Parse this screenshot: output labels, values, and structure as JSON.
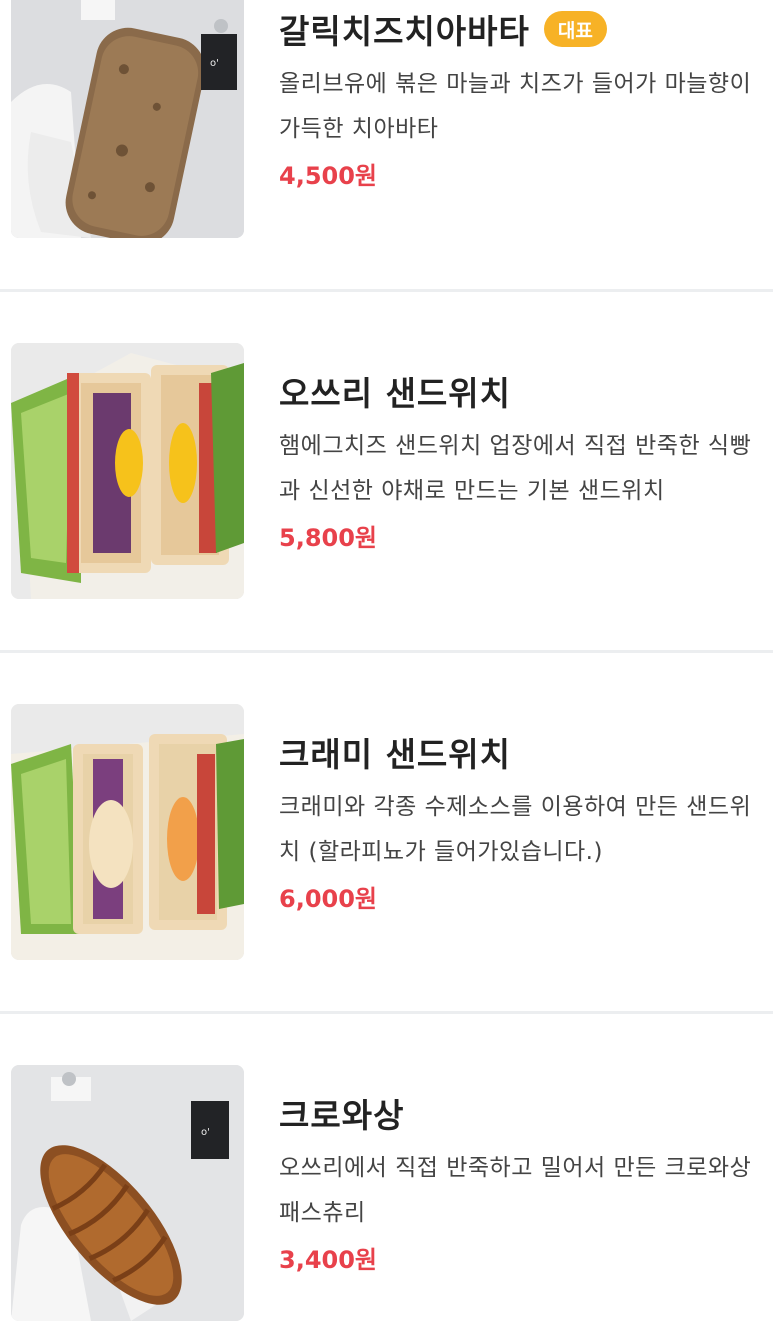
{
  "menu": {
    "items": [
      {
        "name": "갈릭치즈치아바타",
        "badge": "대표",
        "description": "올리브유에 볶은 마늘과 치즈가 들어가 마늘향이 가득한 치아바타",
        "price": "4,500원",
        "image_icon": "ciabatta-photo"
      },
      {
        "name": "오쓰리 샌드위치",
        "description": "햄에그치즈 샌드위치 업장에서 직접 반죽한 식빵과 신선한 야채로 만드는 기본 샌드위치",
        "price": "5,800원",
        "image_icon": "sandwich-photo"
      },
      {
        "name": "크래미 샌드위치",
        "description": "크래미와 각종 수제소스를 이용하여 만든 샌드위치 (할라피뇨가 들어가있습니다.)",
        "price": "6,000원",
        "image_icon": "sandwich-photo"
      },
      {
        "name": "크로와상",
        "description": "오쓰리에서 직접 반죽하고 밀어서 만든 크로와상 패스츄리",
        "price": "3,400원",
        "image_icon": "croissant-photo"
      }
    ]
  },
  "colors": {
    "price": "#e8414b",
    "badge": "#f7b226",
    "divider": "#eceef0"
  }
}
